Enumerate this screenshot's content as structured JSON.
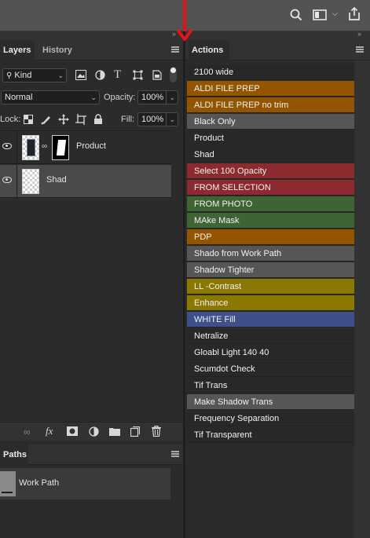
{
  "topbar": {
    "icons": [
      "search-icon",
      "workspace-icon",
      "chevron-down-icon",
      "share-icon"
    ]
  },
  "layers_panel": {
    "tabs": [
      {
        "label": "Layers",
        "active": true
      },
      {
        "label": "History",
        "active": false
      }
    ],
    "filter": {
      "value": "Kind",
      "icons": [
        "image-filter-icon",
        "adjustment-filter-icon",
        "type-filter-icon",
        "shape-filter-icon",
        "smart-object-filter-icon",
        "filter-toggle"
      ]
    },
    "blend_mode": "Normal",
    "opacity_label": "Opacity:",
    "opacity_value": "100%",
    "lock_label": "Lock:",
    "fill_label": "Fill:",
    "fill_value": "100%",
    "layers": [
      {
        "name": "Product",
        "selected": false,
        "visible": true,
        "has_mask": true
      },
      {
        "name": "Shad",
        "selected": true,
        "visible": true,
        "has_mask": false
      }
    ],
    "bottom_icons": [
      "link-icon",
      "fx-icon",
      "mask-icon",
      "adjustment-icon",
      "folder-icon",
      "new-layer-icon",
      "trash-icon"
    ],
    "fx_label": "fx"
  },
  "paths_panel": {
    "tab": "Paths",
    "paths": [
      {
        "name": "Work Path"
      }
    ]
  },
  "actions_panel": {
    "tab": "Actions",
    "actions": [
      {
        "label": "2100 wide",
        "color": "none"
      },
      {
        "label": "ALDI FILE PREP",
        "color": "orange"
      },
      {
        "label": "ALDI FILE PREP no trim",
        "color": "orange"
      },
      {
        "label": "Black Only",
        "color": "gray"
      },
      {
        "label": "Product",
        "color": "none"
      },
      {
        "label": "Shad",
        "color": "none"
      },
      {
        "label": "Select 100 Opacity",
        "color": "red"
      },
      {
        "label": "FROM SELECTION",
        "color": "red"
      },
      {
        "label": "FROM PHOTO",
        "color": "green"
      },
      {
        "label": "MAke Mask",
        "color": "green"
      },
      {
        "label": "PDP",
        "color": "orange"
      },
      {
        "label": "Shado from Work Path",
        "color": "gray"
      },
      {
        "label": "Shadow Tighter",
        "color": "gray"
      },
      {
        "label": "LL -Contrast",
        "color": "yellow"
      },
      {
        "label": "Enhance",
        "color": "yellow"
      },
      {
        "label": "WHITE Fill",
        "color": "blue"
      },
      {
        "label": "Netralize",
        "color": "none"
      },
      {
        "label": "Gloabl Light 140 40",
        "color": "none"
      },
      {
        "label": "Scumdot Check",
        "color": "none"
      },
      {
        "label": "Tif Trans",
        "color": "none"
      },
      {
        "label": "Make Shadow Trans",
        "color": "gray"
      },
      {
        "label": "Frequency Separation",
        "color": "none"
      },
      {
        "label": "Tif Transparent",
        "color": "none"
      }
    ]
  },
  "colors": {
    "panel_bg": "#2b2b2b",
    "topbar_bg": "#535353",
    "orange": "#935500",
    "red": "#8d2a2f",
    "green": "#3f6433",
    "yellow": "#8a7800",
    "blue": "#3e4f8a",
    "gray": "#565656",
    "annotation_arrow": "#e0151b"
  }
}
